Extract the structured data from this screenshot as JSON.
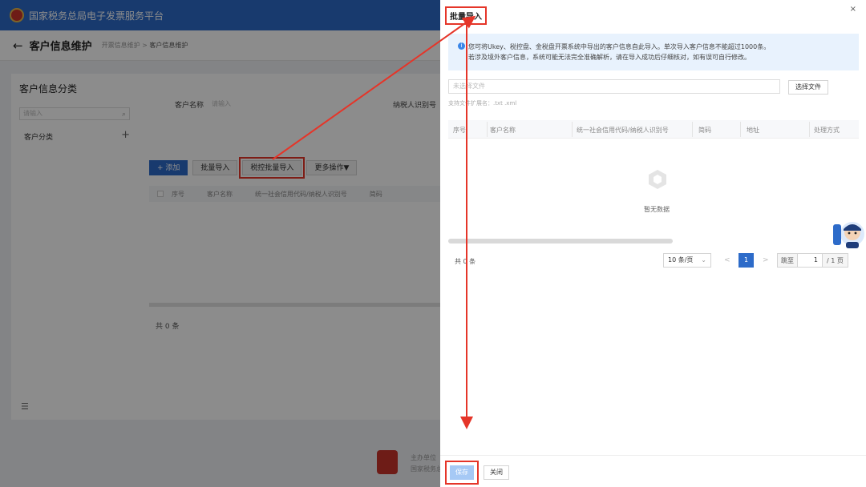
{
  "topbar": {
    "title": "国家税务总局电子发票服务平台"
  },
  "subhead": {
    "back_icon": "arrow-left-icon",
    "title": "客户信息维护",
    "crumb_parent": "开票信息维护",
    "crumb_sep": ">",
    "crumb_current": "客户信息维护"
  },
  "sidebar": {
    "title": "客户信息分类",
    "search_placeholder": "请输入",
    "category": "客户分类",
    "add_symbol": "+",
    "menu_symbol": "☰"
  },
  "main": {
    "filter_name_label": "客户名称",
    "filter_name_placeholder": "请输入",
    "filter_tax_label": "纳税人识别号",
    "buttons": {
      "add": "+ 添加",
      "batch_import": "批量导入",
      "tax_batch_import": "税控批量导入",
      "more": "更多操作▼"
    },
    "table_headers": [
      "序号",
      "客户名称",
      "统一社会信用代码/纳税人识别号",
      "简码"
    ],
    "total": "共 0 条"
  },
  "footer": {
    "text1": "主办单位",
    "text2": "国家税务总局"
  },
  "drawer": {
    "title": "批量导入",
    "close": "×",
    "info_line1": "您可将Ukey、税控盘、金税盘开票系统中导出的客户信息自此导入。单次导入客户信息不能超过1000条。",
    "info_line2": "若涉及境外客户信息，系统可能无法完全准确解析，请在导入成功后仔细核对，如有误可自行修改。",
    "file_placeholder": "未选择文件",
    "choose_file": "选择文件",
    "supported_ext": "支持文件扩展名：.txt .xml",
    "table_headers": [
      "序号",
      "客户名称",
      "统一社会信用代码/纳税人识别号",
      "简码",
      "地址",
      "处理方式"
    ],
    "empty_text": "暂无数据",
    "pager": {
      "total": "共 0 条",
      "page_size": "10 条/页",
      "prev": "<",
      "current_page": "1",
      "next": ">",
      "jump_label": "跳至",
      "jump_value": "1",
      "page_total": "/ 1 页"
    },
    "save": "保存",
    "close_button": "关闭"
  },
  "colors": {
    "brand_blue": "#2d6bc9",
    "annotation_red": "#e53529",
    "info_bg": "#e8f2fd"
  }
}
